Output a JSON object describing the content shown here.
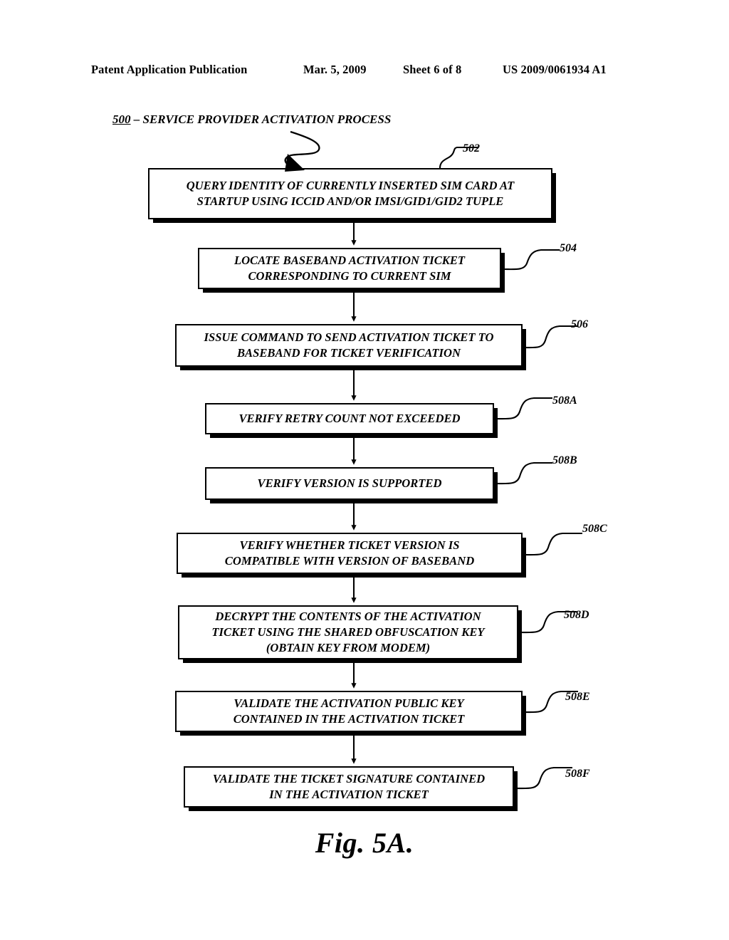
{
  "header": {
    "publication": "Patent Application Publication",
    "date": "Mar. 5, 2009",
    "sheet": "Sheet 6 of 8",
    "patent_number": "US 2009/0061934 A1"
  },
  "figure": {
    "title_number": "500",
    "title_dash": " – ",
    "title_text": "SERVICE PROVIDER ACTIVATION PROCESS",
    "caption": "Fig. 5A."
  },
  "flowchart": {
    "type": "flowchart",
    "orientation": "top-to-bottom",
    "steps": [
      {
        "ref": "502",
        "lines": [
          "QUERY IDENTITY OF CURRENTLY INSERTED SIM CARD AT",
          "STARTUP USING ICCID AND/OR IMSI/GID1/GID2 TUPLE"
        ]
      },
      {
        "ref": "504",
        "lines": [
          "LOCATE BASEBAND ACTIVATION TICKET",
          "CORRESPONDING TO CURRENT SIM"
        ]
      },
      {
        "ref": "506",
        "lines": [
          "ISSUE COMMAND TO SEND ACTIVATION TICKET TO",
          "BASEBAND FOR TICKET VERIFICATION"
        ]
      },
      {
        "ref": "508A",
        "lines": [
          "VERIFY RETRY COUNT NOT EXCEEDED"
        ]
      },
      {
        "ref": "508B",
        "lines": [
          "VERIFY VERSION IS SUPPORTED"
        ]
      },
      {
        "ref": "508C",
        "lines": [
          "VERIFY WHETHER TICKET VERSION IS",
          "COMPATIBLE WITH VERSION OF BASEBAND"
        ]
      },
      {
        "ref": "508D",
        "lines": [
          "DECRYPT THE CONTENTS OF THE ACTIVATION",
          "TICKET USING THE SHARED OBFUSCATION KEY",
          "(OBTAIN KEY FROM MODEM)"
        ]
      },
      {
        "ref": "508E",
        "lines": [
          "VALIDATE THE ACTIVATION PUBLIC KEY",
          "CONTAINED IN THE ACTIVATION TICKET"
        ]
      },
      {
        "ref": "508F",
        "lines": [
          "VALIDATE THE TICKET SIGNATURE CONTAINED",
          "IN THE ACTIVATION TICKET"
        ]
      }
    ]
  },
  "colors": {
    "ink": "#000000",
    "paper": "#ffffff"
  }
}
